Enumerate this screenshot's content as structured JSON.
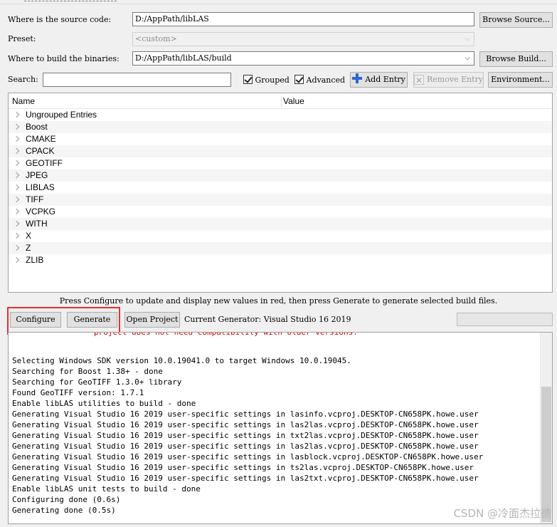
{
  "source": {
    "label": "Where is the source code:",
    "value": "D:/AppPath/libLAS",
    "browse_label": "Browse Source..."
  },
  "preset": {
    "label": "Preset:",
    "value": "<custom>"
  },
  "build": {
    "label": "Where to build the binaries:",
    "value": "D:/AppPath/libLAS/build",
    "browse_label": "Browse Build..."
  },
  "search": {
    "label": "Search:",
    "value": ""
  },
  "toolbar": {
    "grouped_label": "Grouped",
    "advanced_label": "Advanced",
    "add_entry_label": "Add Entry",
    "remove_entry_label": "Remove Entry",
    "environment_label": "Environment..."
  },
  "tree": {
    "columns": [
      "Name",
      "Value"
    ],
    "groups": [
      "Ungrouped Entries",
      "Boost",
      "CMAKE",
      "CPACK",
      "GEOTIFF",
      "JPEG",
      "LIBLAS",
      "TIFF",
      "VCPKG",
      "WITH",
      "X",
      "Z",
      "ZLIB"
    ]
  },
  "hint": "Press Configure to update and display new values in red, then press Generate to generate selected build files.",
  "actions": {
    "configure_label": "Configure",
    "generate_label": "Generate",
    "open_project_label": "Open Project",
    "current_generator": "Current Generator: Visual Studio 16 2019"
  },
  "output": {
    "partial_red_line": "project does not need compatibility with older versions.",
    "lines": [
      "Selecting Windows SDK version 10.0.19041.0 to target Windows 10.0.19045.",
      "Searching for Boost 1.38+ - done",
      "Searching for GeoTIFF 1.3.0+ library",
      "Found GeoTIFF version: 1.7.1",
      "Enable libLAS utilities to build - done",
      "Generating Visual Studio 16 2019 user-specific settings in lasinfo.vcproj.DESKTOP-CN658PK.howe.user",
      "Generating Visual Studio 16 2019 user-specific settings in las2las.vcproj.DESKTOP-CN658PK.howe.user",
      "Generating Visual Studio 16 2019 user-specific settings in txt2las.vcproj.DESKTOP-CN658PK.howe.user",
      "Generating Visual Studio 16 2019 user-specific settings in las2las.vcproj.DESKTOP-CN658PK.howe.user",
      "Generating Visual Studio 16 2019 user-specific settings in lasblock.vcproj.DESKTOP-CN658PK.howe.user",
      "Generating Visual Studio 16 2019 user-specific settings in ts2las.vcproj.DESKTOP-CN658PK.howe.user",
      "Generating Visual Studio 16 2019 user-specific settings in las2txt.vcproj.DESKTOP-CN658PK.howe.user",
      "Enable libLAS unit tests to build - done",
      "Configuring done (0.6s)",
      "Generating done (0.5s)"
    ]
  },
  "watermark": "CSDN @冷面杰拉德",
  "colors": {
    "highlight_box": "#e8302e",
    "red_text": "#d40000",
    "add_icon": "#2f64d6"
  }
}
